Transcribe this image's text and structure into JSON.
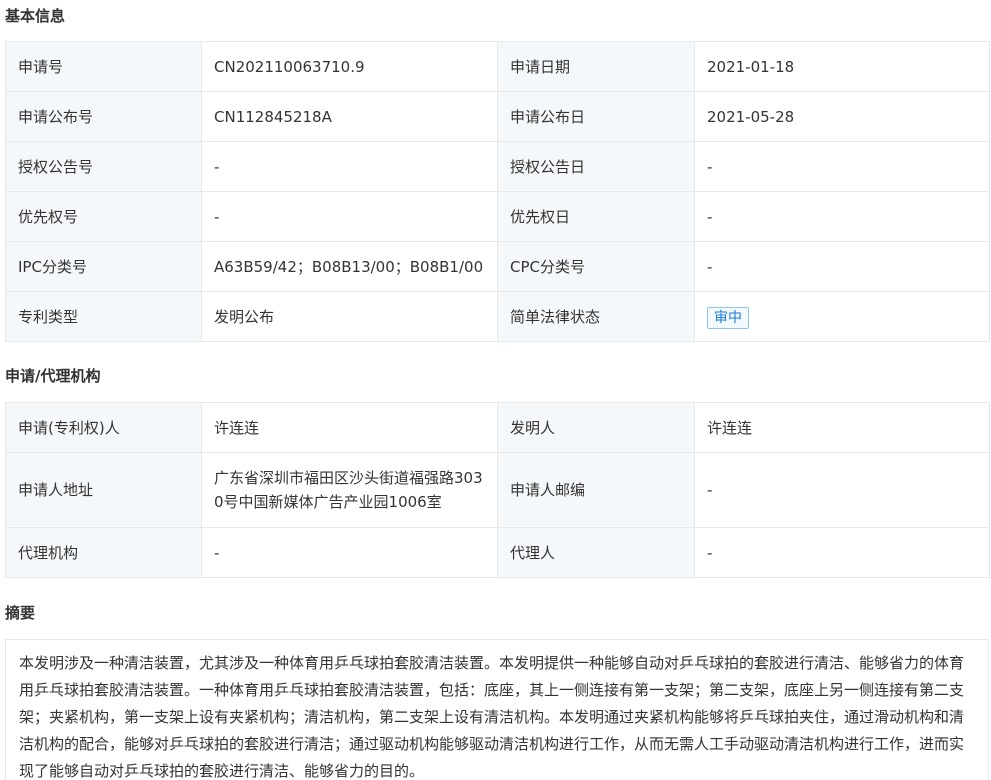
{
  "basic": {
    "title": "基本信息",
    "rows": [
      {
        "l1": "申请号",
        "v1": "CN202110063710.9",
        "l2": "申请日期",
        "v2": "2021-01-18"
      },
      {
        "l1": "申请公布号",
        "v1": "CN112845218A",
        "l2": "申请公布日",
        "v2": "2021-05-28"
      },
      {
        "l1": "授权公告号",
        "v1": "-",
        "l2": "授权公告日",
        "v2": "-"
      },
      {
        "l1": "优先权号",
        "v1": "-",
        "l2": "优先权日",
        "v2": "-"
      },
      {
        "l1": "IPC分类号",
        "v1": "A63B59/42；B08B13/00；B08B1/00",
        "l2": "CPC分类号",
        "v2": "-"
      },
      {
        "l1": "专利类型",
        "v1": "发明公布",
        "l2": "简单法律状态",
        "v2": "审中"
      }
    ]
  },
  "agency": {
    "title": "申请/代理机构",
    "rows": [
      {
        "l1": "申请(专利权)人",
        "v1": "许连连",
        "l2": "发明人",
        "v2": "许连连"
      },
      {
        "l1": "申请人地址",
        "v1": "广东省深圳市福田区沙头街道福强路3030号中国新媒体广告产业园1006室",
        "l2": "申请人邮编",
        "v2": "-"
      },
      {
        "l1": "代理机构",
        "v1": "-",
        "l2": "代理人",
        "v2": "-"
      }
    ]
  },
  "abstract": {
    "title": "摘要",
    "text": "本发明涉及一种清洁装置，尤其涉及一种体育用乒乓球拍套胶清洁装置。本发明提供一种能够自动对乒乓球拍的套胶进行清洁、能够省力的体育用乒乓球拍套胶清洁装置。一种体育用乒乓球拍套胶清洁装置，包括：底座，其上一侧连接有第一支架；第二支架，底座上另一侧连接有第二支架；夹紧机构，第一支架上设有夹紧机构；清洁机构，第二支架上设有清洁机构。本发明通过夹紧机构能够将乒乓球拍夹住，通过滑动机构和清洁机构的配合，能够对乒乓球拍的套胶进行清洁；通过驱动机构能够驱动清洁机构进行工作，从而无需人工手动驱动清洁机构进行工作，进而实现了能够自动对乒乓球拍的套胶进行清洁、能够省力的目的。"
  },
  "colors": {
    "label_bg": "#f5f8fa",
    "border": "#e8e8e8",
    "badge_text": "#1a7dd6",
    "badge_border": "#8ec5e9"
  }
}
